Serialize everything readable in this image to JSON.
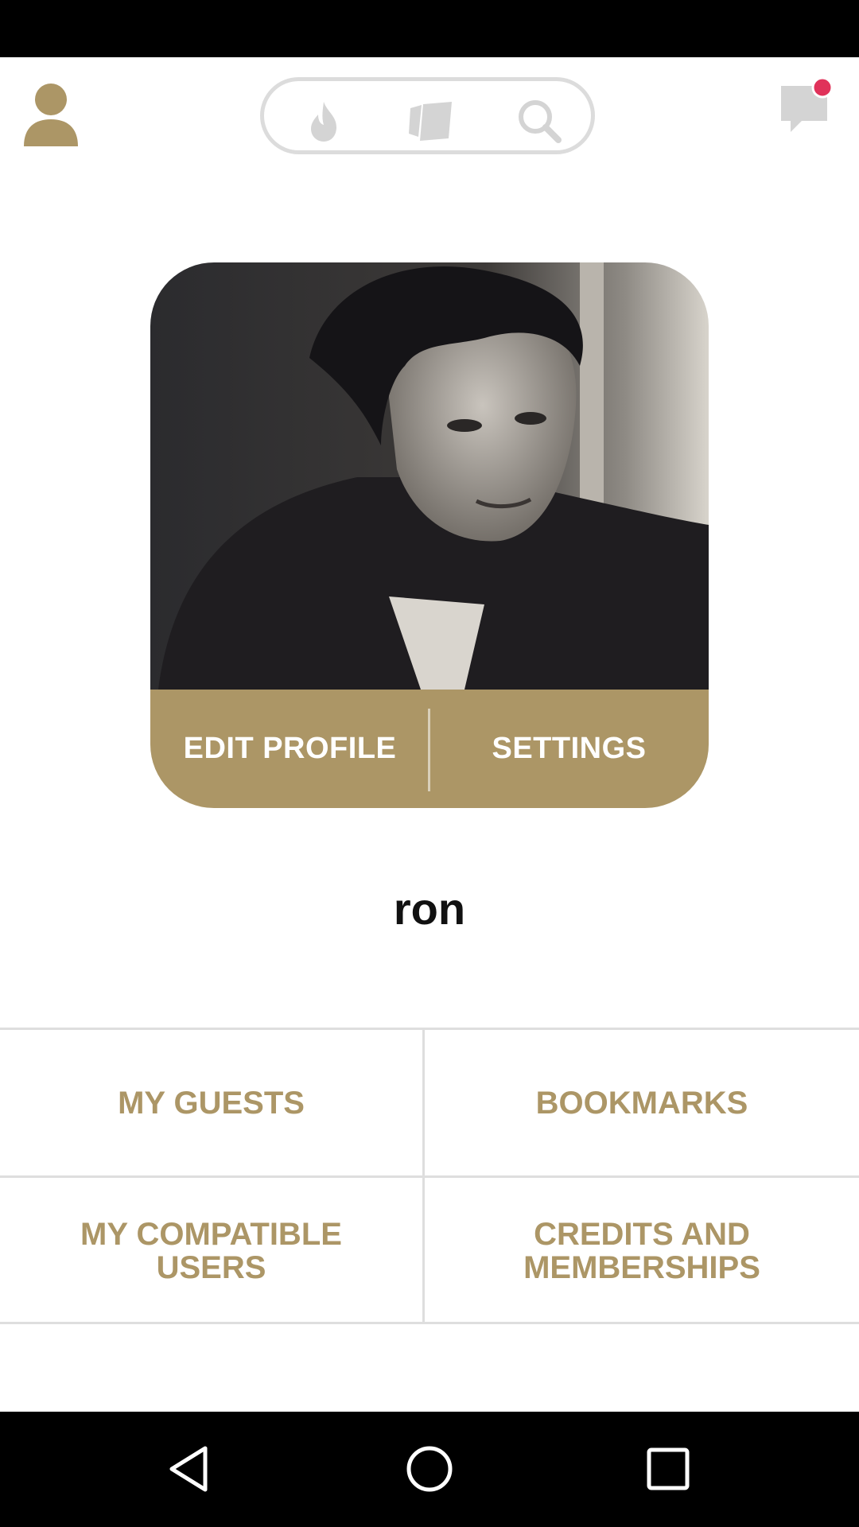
{
  "colors": {
    "accent": "#ac9666",
    "badge": "#e0325a",
    "inactive_icon": "#d4d4d4"
  },
  "top_bar": {
    "profile_icon": "person-icon",
    "modes": [
      "flame-icon",
      "cards-icon",
      "search-icon"
    ],
    "messages_icon": "chat-icon",
    "messages_has_unread": true
  },
  "profile": {
    "photo": "profile-photo",
    "edit_label": "EDIT PROFILE",
    "settings_label": "SETTINGS",
    "name": "ron"
  },
  "menu": {
    "guests": "MY GUESTS",
    "bookmarks": "BOOKMARKS",
    "compatible_line1": "MY COMPATIBLE",
    "compatible_line2": "USERS",
    "credits_line1": "CREDITS AND",
    "credits_line2": "MEMBERSHIPS"
  },
  "nav_bar": {
    "icons": [
      "back-icon",
      "home-icon",
      "recents-icon"
    ]
  }
}
